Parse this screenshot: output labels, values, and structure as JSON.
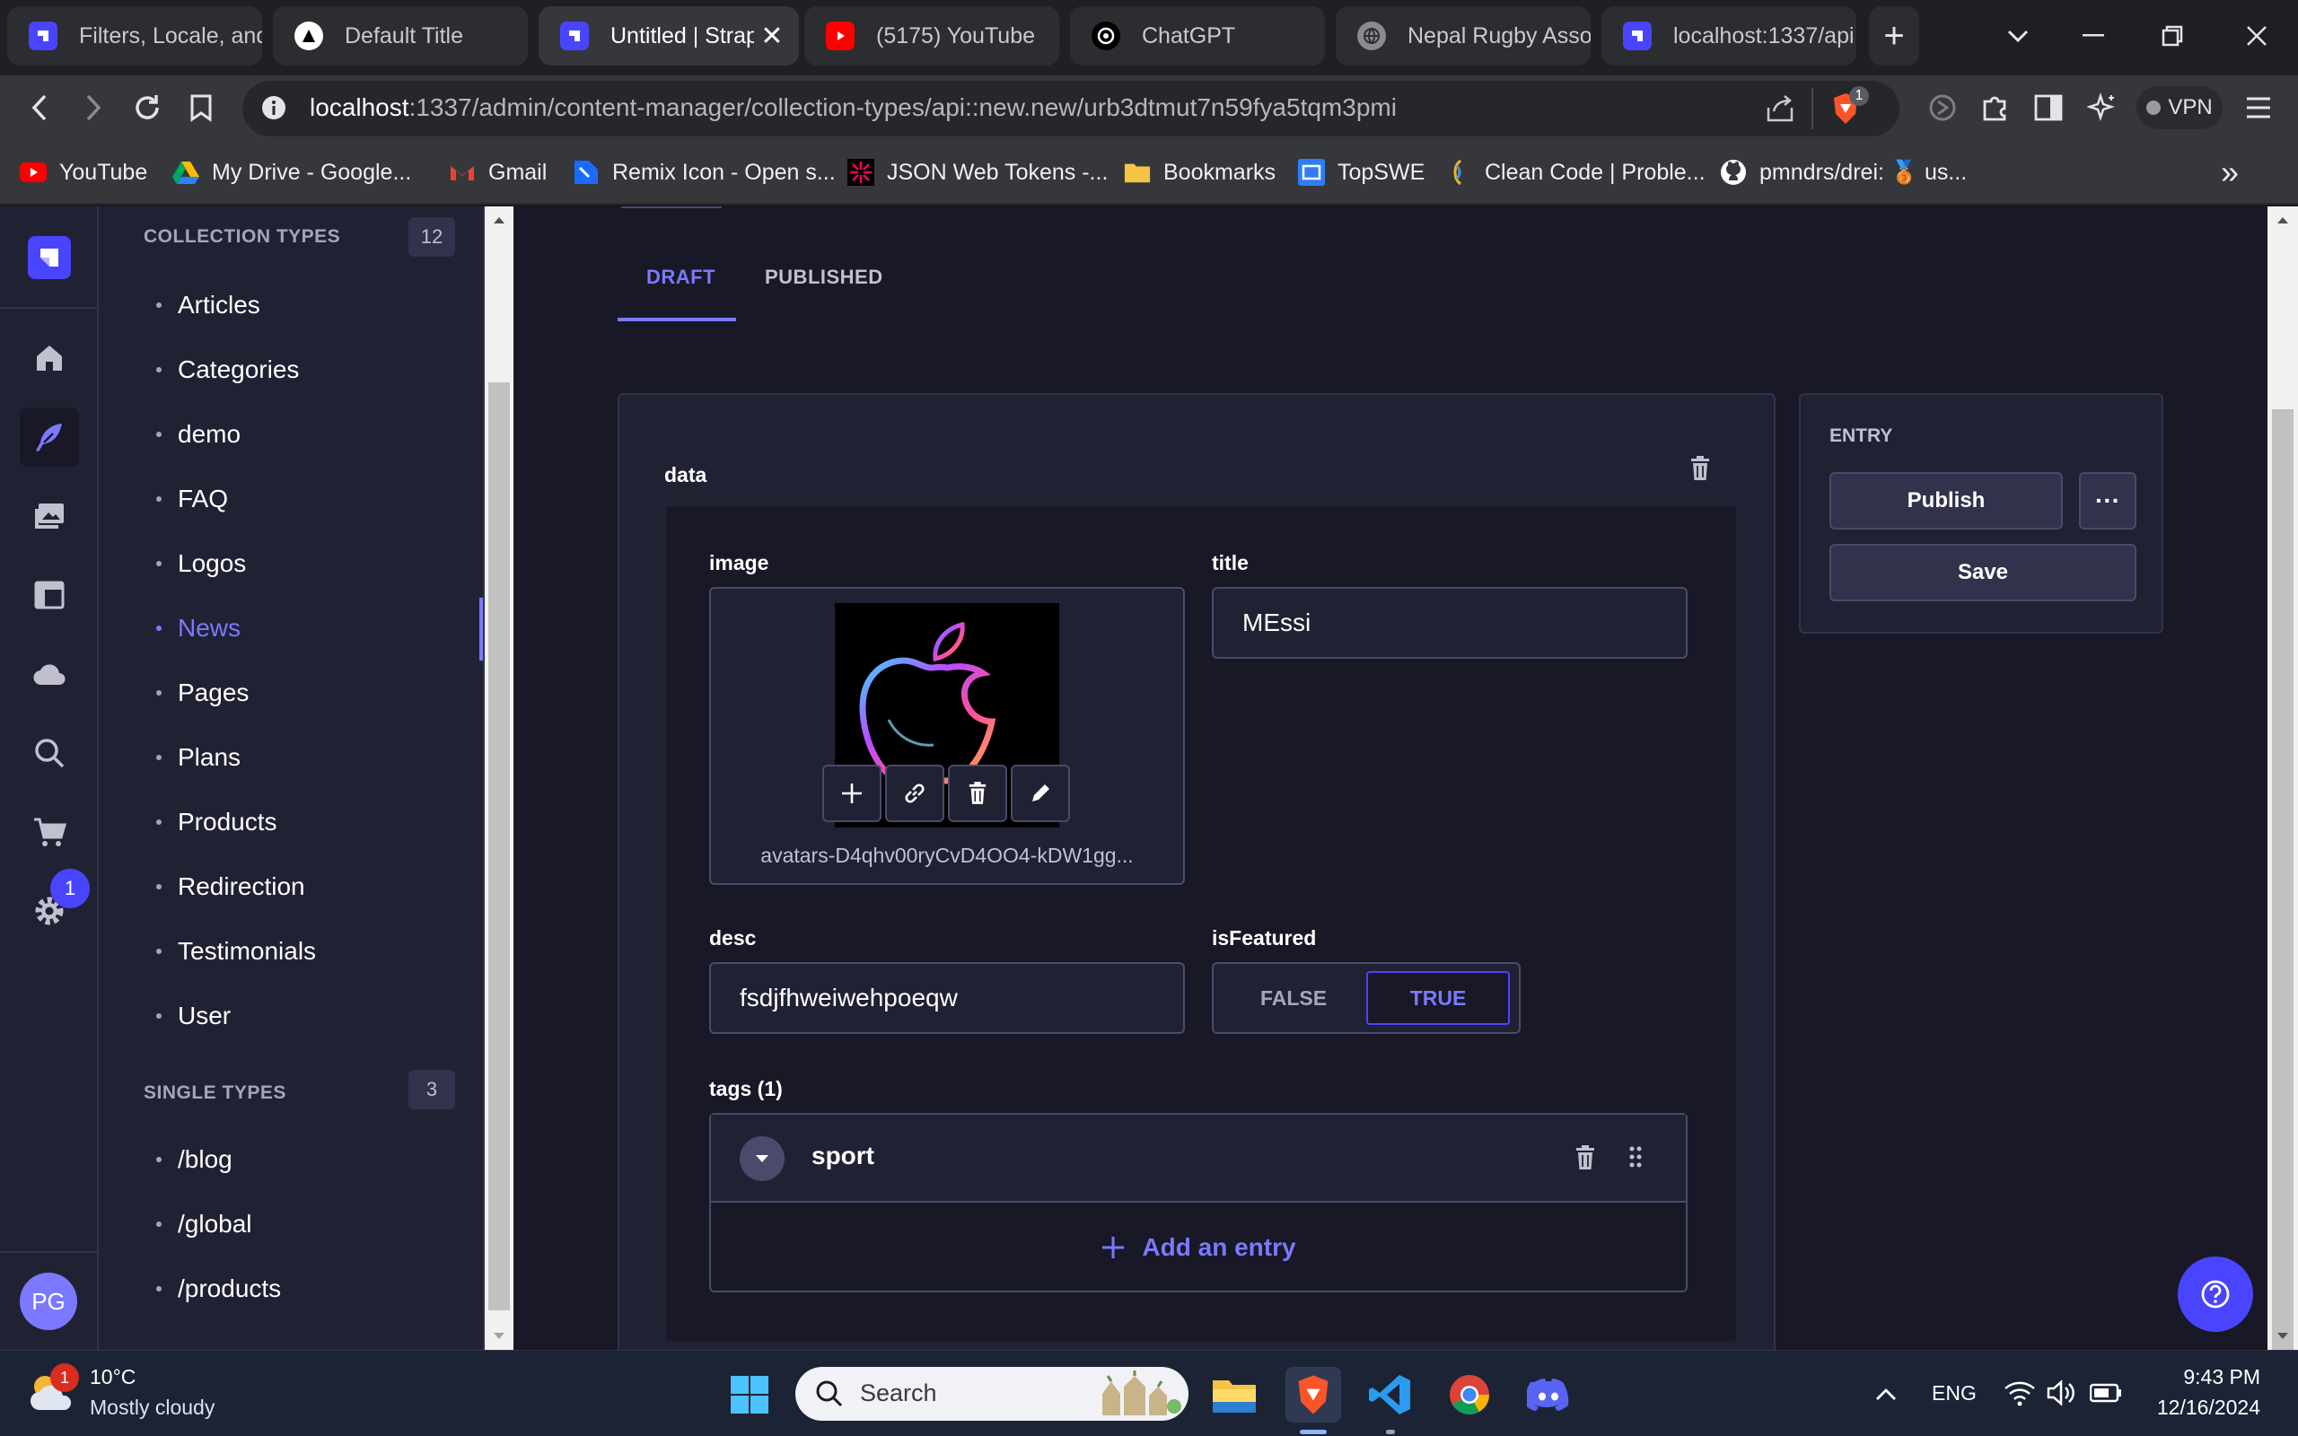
{
  "browser": {
    "tabs": [
      {
        "label": "Filters, Locale, and",
        "icon": "strapi-icon",
        "active": false
      },
      {
        "label": "Default Title",
        "icon": "nextjs-icon",
        "active": false
      },
      {
        "label": "Untitled | Strap",
        "icon": "strapi-icon",
        "active": true
      },
      {
        "label": "(5175) YouTube",
        "icon": "youtube-icon",
        "active": false
      },
      {
        "label": "ChatGPT",
        "icon": "chatgpt-icon",
        "active": false
      },
      {
        "label": "Nepal Rugby Asso",
        "icon": "globe-icon",
        "active": false
      },
      {
        "label": "localhost:1337/api",
        "icon": "strapi-icon",
        "active": false
      }
    ],
    "url_host": "localhost",
    "url_path": ":1337/admin/content-manager/collection-types/api::new.new/urb3dtmut7n59fya5tqm3pmi",
    "brave_badge": "1",
    "vpn_label": "VPN",
    "bookmarks": [
      {
        "label": "YouTube",
        "icon": "youtube-icon"
      },
      {
        "label": "My Drive - Google...",
        "icon": "google-drive-icon"
      },
      {
        "label": "Gmail",
        "icon": "gmail-icon"
      },
      {
        "label": "Remix Icon - Open s...",
        "icon": "remix-icon"
      },
      {
        "label": "JSON Web Tokens -...",
        "icon": "jwt-icon"
      },
      {
        "label": "Bookmarks",
        "icon": "folder-icon"
      },
      {
        "label": "TopSWE",
        "icon": "topswe-icon"
      },
      {
        "label": "Clean Code | Proble...",
        "icon": "cleancode-icon"
      },
      {
        "label": "pmndrs/drei: 🥉 us...",
        "icon": "github-icon"
      }
    ],
    "more_bookmarks": "»"
  },
  "rail": {
    "settings_badge": "1",
    "avatar_initials": "PG"
  },
  "subnav": {
    "collection_heading": "COLLECTION TYPES",
    "collection_count": "12",
    "collection_items": [
      "Articles",
      "Categories",
      "demo",
      "FAQ",
      "Logos",
      "News",
      "Pages",
      "Plans",
      "Products",
      "Redirection",
      "Testimonials",
      "User"
    ],
    "active_item": "News",
    "single_heading": "SINGLE TYPES",
    "single_count": "3",
    "single_items": [
      "/blog",
      "/global",
      "/products"
    ]
  },
  "main": {
    "tabs": [
      "DRAFT",
      "PUBLISHED"
    ],
    "active_tab": "DRAFT",
    "component_label": "data",
    "image_label": "image",
    "image_filename": "avatars-D4qhv00ryCvD4OO4-kDW1gg...",
    "title_label": "title",
    "title_value": "MEssi",
    "desc_label": "desc",
    "desc_value": "fsdjfhweiwehpoeqw",
    "featured_label": "isFeatured",
    "featured_false": "FALSE",
    "featured_true": "TRUE",
    "featured_value": true,
    "tags_label": "tags (1)",
    "tag_entry": "sport",
    "add_entry_label": "Add an entry"
  },
  "entry": {
    "heading": "ENTRY",
    "publish_label": "Publish",
    "more_label": "···",
    "save_label": "Save"
  },
  "taskbar": {
    "weather_temp": "10°C",
    "weather_desc": "Mostly cloudy",
    "weather_badge": "1",
    "search_placeholder": "Search",
    "language": "ENG",
    "time": "9:43 PM",
    "date": "12/16/2024"
  },
  "colors": {
    "accent": "#7b79ff",
    "primary_button": "#4945ff",
    "panel": "#212134",
    "background": "#181826"
  }
}
